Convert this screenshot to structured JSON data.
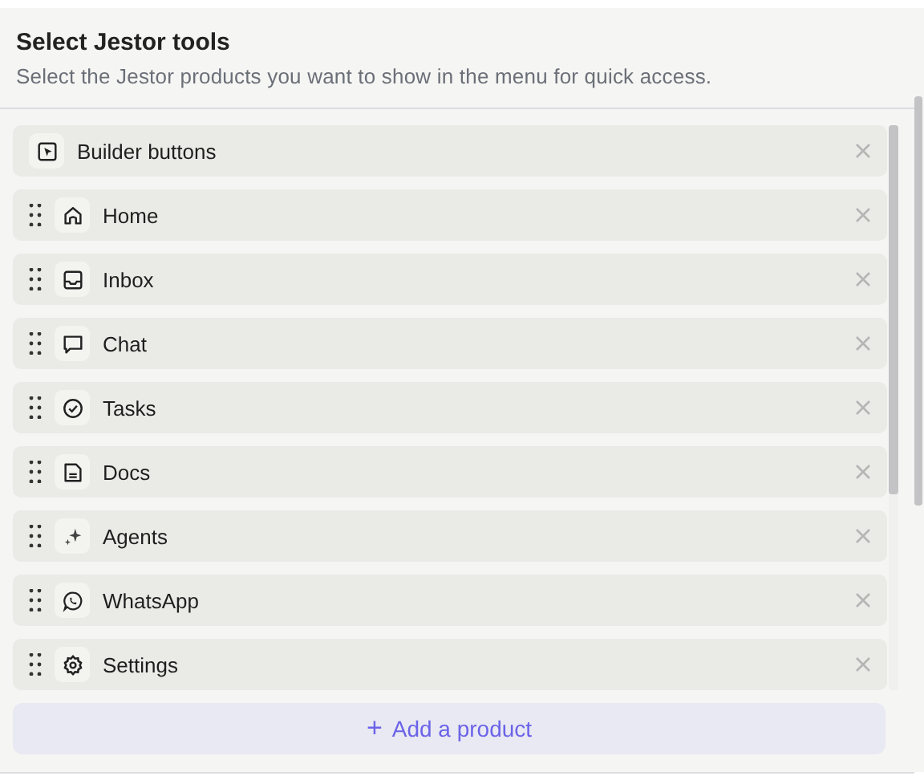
{
  "header": {
    "title": "Select Jestor tools",
    "subtitle": "Select the Jestor products you want to show in the menu for quick access."
  },
  "tools": [
    {
      "label": "Builder buttons",
      "draggable": false
    },
    {
      "label": "Home",
      "draggable": true
    },
    {
      "label": "Inbox",
      "draggable": true
    },
    {
      "label": "Chat",
      "draggable": true
    },
    {
      "label": "Tasks",
      "draggable": true
    },
    {
      "label": "Docs",
      "draggable": true
    },
    {
      "label": "Agents",
      "draggable": true
    },
    {
      "label": "WhatsApp",
      "draggable": true
    },
    {
      "label": "Settings",
      "draggable": true
    }
  ],
  "add_button": {
    "icon": "+",
    "label": "Add a product"
  }
}
